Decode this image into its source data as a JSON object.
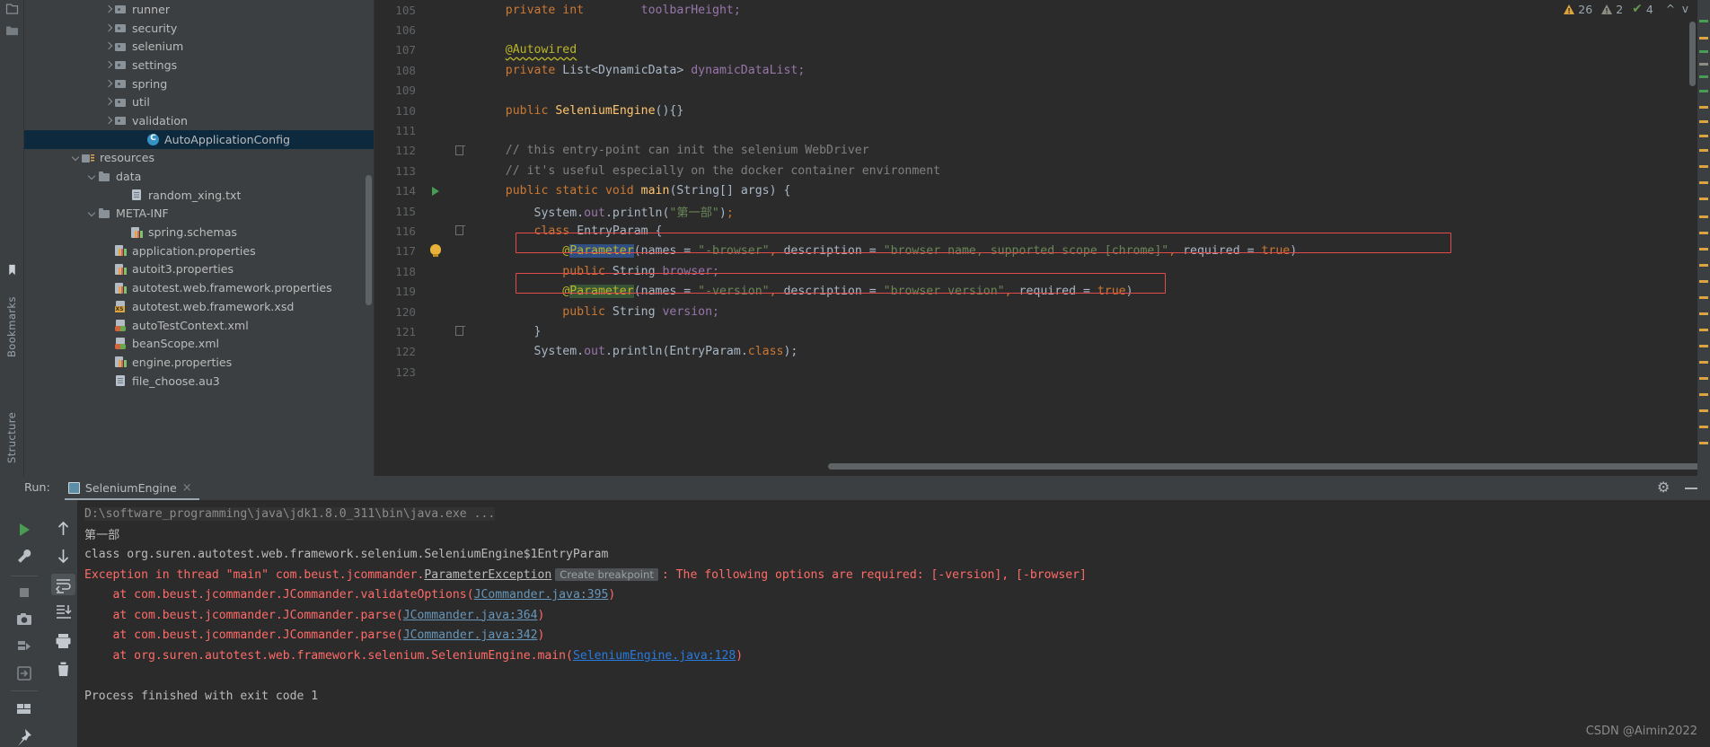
{
  "left_strip": {
    "top_icons": [
      "project-icon",
      "folder-icon"
    ],
    "bottom_labels": [
      "Bookmarks",
      "Structure"
    ]
  },
  "project_tree": {
    "items": [
      {
        "label": "runner",
        "indent": 104,
        "arrow": "right",
        "icon": "folder-dot-icon",
        "selected": false
      },
      {
        "label": "security",
        "indent": 104,
        "arrow": "right",
        "icon": "folder-dot-icon",
        "selected": false
      },
      {
        "label": "selenium",
        "indent": 104,
        "arrow": "right",
        "icon": "folder-dot-icon",
        "selected": false
      },
      {
        "label": "settings",
        "indent": 104,
        "arrow": "right",
        "icon": "folder-dot-icon",
        "selected": false
      },
      {
        "label": "spring",
        "indent": 104,
        "arrow": "right",
        "icon": "folder-dot-icon",
        "selected": false
      },
      {
        "label": "util",
        "indent": 104,
        "arrow": "right",
        "icon": "folder-dot-icon",
        "selected": false
      },
      {
        "label": "validation",
        "indent": 104,
        "arrow": "right",
        "icon": "folder-dot-icon",
        "selected": false
      },
      {
        "label": "AutoApplicationConfig",
        "indent": 140,
        "arrow": "none",
        "icon": "java-class-icon",
        "selected": true
      },
      {
        "label": "resources",
        "indent": 68,
        "arrow": "down",
        "icon": "resources-folder-icon",
        "selected": false
      },
      {
        "label": "data",
        "indent": 86,
        "arrow": "down",
        "icon": "folder-icon",
        "selected": false
      },
      {
        "label": "random_xing.txt",
        "indent": 122,
        "arrow": "none",
        "icon": "text-file-icon",
        "selected": false
      },
      {
        "label": "META-INF",
        "indent": 86,
        "arrow": "down",
        "icon": "folder-icon",
        "selected": false
      },
      {
        "label": "spring.schemas",
        "indent": 122,
        "arrow": "none",
        "icon": "properties-file-icon",
        "selected": false
      },
      {
        "label": "application.properties",
        "indent": 104,
        "arrow": "none",
        "icon": "properties-file-icon",
        "selected": false
      },
      {
        "label": "autoit3.properties",
        "indent": 104,
        "arrow": "none",
        "icon": "properties-file-icon",
        "selected": false
      },
      {
        "label": "autotest.web.framework.properties",
        "indent": 104,
        "arrow": "none",
        "icon": "properties-file-icon",
        "selected": false
      },
      {
        "label": "autotest.web.framework.xsd",
        "indent": 104,
        "arrow": "none",
        "icon": "xsd-file-icon",
        "selected": false
      },
      {
        "label": "autoTestContext.xml",
        "indent": 104,
        "arrow": "none",
        "icon": "xml-file-icon",
        "selected": false
      },
      {
        "label": "beanScope.xml",
        "indent": 104,
        "arrow": "none",
        "icon": "xml-file-icon",
        "selected": false
      },
      {
        "label": "engine.properties",
        "indent": 104,
        "arrow": "none",
        "icon": "properties-file-icon",
        "selected": false
      },
      {
        "label": "file_choose.au3",
        "indent": 104,
        "arrow": "none",
        "icon": "au3-file-icon",
        "selected": false
      }
    ]
  },
  "editor": {
    "line_numbers": [
      "105",
      "106",
      "107",
      "108",
      "109",
      "110",
      "111",
      "112",
      "113",
      "114",
      "115",
      "116",
      "117",
      "118",
      "119",
      "120",
      "121",
      "122",
      "123"
    ],
    "lines": [
      {
        "n": "105",
        "text": "    private int        toolbarHeight;"
      },
      {
        "n": "106",
        "text": ""
      },
      {
        "n": "107",
        "text": "    @Autowired"
      },
      {
        "n": "108",
        "text": "    private List<DynamicData> dynamicDataList;"
      },
      {
        "n": "109",
        "text": ""
      },
      {
        "n": "110",
        "text": "    public SeleniumEngine(){}"
      },
      {
        "n": "111",
        "text": ""
      },
      {
        "n": "112",
        "text": "    // this entry-point can init the selenium WebDriver"
      },
      {
        "n": "113",
        "text": "    // it's useful especially on the docker container environment"
      },
      {
        "n": "114",
        "text": "    public static void main(String[] args) {"
      },
      {
        "n": "115",
        "text": "        System.out.println(\"第一部\");"
      },
      {
        "n": "116",
        "text": "        class EntryParam {"
      },
      {
        "n": "117",
        "text": "            @Parameter(names = \"-browser\", description = \"browser name, supported scope [chrome]\", required = true)"
      },
      {
        "n": "118",
        "text": "            public String browser;"
      },
      {
        "n": "119",
        "text": "            @Parameter(names = \"-version\", description = \"browser version\", required = true)"
      },
      {
        "n": "120",
        "text": "            public String version;"
      },
      {
        "n": "121",
        "text": "        }"
      },
      {
        "n": "122",
        "text": "        System.out.println(EntryParam.class);"
      },
      {
        "n": "123",
        "text": ""
      }
    ],
    "tokens": {
      "kw_private": "private",
      "kw_public": "public",
      "kw_static": "static",
      "kw_void": "void",
      "kw_class": "class",
      "kw_int": "int",
      "kw_true": "true",
      "type_list": "List",
      "type_dynamicdata": "DynamicData",
      "type_string": "String",
      "field_toolbarHeight": "toolbarHeight;",
      "field_dynamicDataList": "dynamicDataList;",
      "ann_autowired": "@Autowired",
      "ann_parameter": "@Parameter",
      "ctor_name": "SeleniumEngine",
      "main_name": "main",
      "comment1": "// this entry-point can init the selenium WebDriver",
      "comment2": "// it's useful especially on the docker container environment",
      "entry_param": "EntryParam",
      "str_first": "\"第一部\"",
      "str_browser_flag": "\"-browser\"",
      "str_browser_desc": "\"browser name, supported scope [chrome]\"",
      "str_version_flag": "\"-version\"",
      "str_version_desc": "\"browser version\"",
      "kw_class_literal": "class"
    }
  },
  "inspection_widget": {
    "warnings_count": "26",
    "weak_warnings_count": "2",
    "checks_count": "4",
    "up_arrow": "^",
    "down_arrow": "v"
  },
  "run_panel": {
    "label": "Run:",
    "tab_name": "SeleniumEngine",
    "tab_close": "×",
    "toolbar_icons": [
      "rerun-play-icon",
      "wrench-icon",
      "stop-icon",
      "camera-icon",
      "thread-dump-icon",
      "export-icon",
      "layout-icon",
      "pin-icon"
    ],
    "toolbar2_icons": [
      "scroll-up-icon",
      "scroll-down-icon",
      "soft-wrap-icon",
      "scroll-to-end-icon",
      "print-icon",
      "clear-all-icon"
    ],
    "header_right_icons": [
      "gear-icon",
      "minimize-icon"
    ]
  },
  "console": {
    "lines": [
      {
        "kind": "cmd",
        "text": "D:\\software_programming\\java\\jdk1.8.0_311\\bin\\java.exe ..."
      },
      {
        "kind": "white",
        "text": "第一部"
      },
      {
        "kind": "white",
        "text": "class org.suren.autotest.web.framework.selenium.SeleniumEngine$1EntryParam"
      },
      {
        "kind": "exception"
      },
      {
        "kind": "trace",
        "prefix": "    at com.beust.jcommander.JCommander.validateOptions(",
        "link": "JCommander.java:395",
        "suffix": ")",
        "bright": false
      },
      {
        "kind": "trace",
        "prefix": "    at com.beust.jcommander.JCommander.parse(",
        "link": "JCommander.java:364",
        "suffix": ")",
        "bright": false
      },
      {
        "kind": "trace",
        "prefix": "    at com.beust.jcommander.JCommander.parse(",
        "link": "JCommander.java:342",
        "suffix": ")",
        "bright": false
      },
      {
        "kind": "trace",
        "prefix": "    at org.suren.autotest.web.framework.selenium.SeleniumEngine.main(",
        "link": "SeleniumEngine.java:128",
        "suffix": ")",
        "bright": true
      },
      {
        "kind": "blank"
      },
      {
        "kind": "white",
        "text": "Process finished with exit code 1"
      }
    ],
    "exception": {
      "part1": "Exception in thread \"main\" com.beust.jcommander.",
      "link": "ParameterException",
      "chip": "Create breakpoint",
      "part2": ": The following options are required: [-version], [-browser]"
    }
  },
  "watermark": "CSDN @Aimin2022",
  "colors": {
    "background": "#2b2b2b",
    "panel": "#3c3f41",
    "selection": "#0d293e",
    "keyword": "#cc7832",
    "string": "#6a8759",
    "annotation": "#bbb529",
    "field": "#9876aa",
    "comment": "#808080",
    "error_red": "#ff6b68",
    "link_blue": "#287bde",
    "run_green": "#499c54",
    "warn_yellow": "#d9a441"
  }
}
